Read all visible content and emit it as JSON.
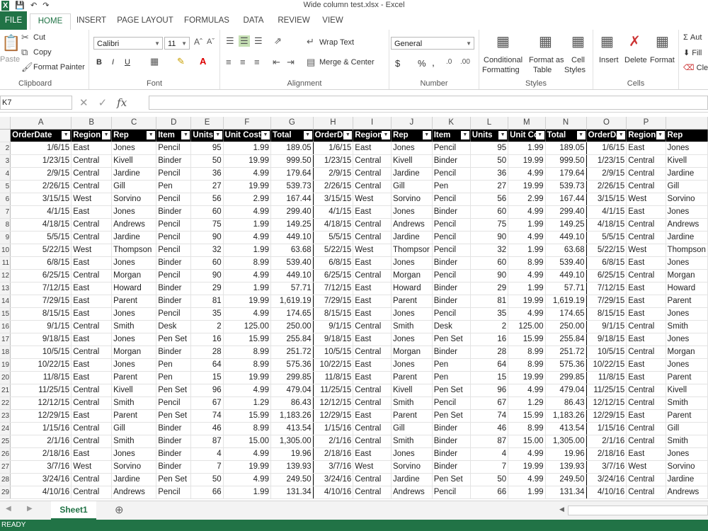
{
  "window": {
    "title": "Wide column test.xlsx - Excel"
  },
  "tabs": {
    "file": "FILE",
    "home": "HOME",
    "insert": "INSERT",
    "page_layout": "PAGE LAYOUT",
    "formulas": "FORMULAS",
    "data": "DATA",
    "review": "REVIEW",
    "view": "VIEW"
  },
  "ribbon": {
    "clipboard": {
      "paste": "Paste",
      "cut": "Cut",
      "copy": "Copy",
      "format_painter": "Format Painter",
      "label": "Clipboard"
    },
    "font": {
      "name": "Calibri",
      "size": "11",
      "bold": "B",
      "italic": "I",
      "underline": "U",
      "label": "Font"
    },
    "alignment": {
      "wrap_text": "Wrap Text",
      "merge_center": "Merge & Center",
      "label": "Alignment"
    },
    "number": {
      "format": "General",
      "currency": "$",
      "percent": "%",
      "comma": ",",
      "label": "Number"
    },
    "styles": {
      "conditional": "Conditional",
      "formatting": "Formatting",
      "format_as": "Format as",
      "table": "Table",
      "cell": "Cell",
      "styles": "Styles",
      "label": "Styles"
    },
    "cells": {
      "insert": "Insert",
      "delete": "Delete",
      "format": "Format",
      "label": "Cells"
    },
    "editing": {
      "autosum": "Aut",
      "fill": "Fill",
      "clear": "Clea"
    }
  },
  "formula_bar": {
    "name_box": "K7",
    "fx": "fx",
    "content": ""
  },
  "columns": [
    "A",
    "B",
    "C",
    "D",
    "E",
    "F",
    "G",
    "H",
    "I",
    "J",
    "K",
    "L",
    "M",
    "N",
    "O",
    "P"
  ],
  "headers": [
    "OrderDate",
    "Region",
    "Rep",
    "Item",
    "Units",
    "Unit Cost",
    "Total"
  ],
  "headers_cut": {
    "orderdate_h": "OrderDa",
    "unitcost_m": "Unit Co",
    "orderdate_o": "OrderDa",
    "rep_q": "Rep"
  },
  "rows": [
    [
      "1/6/15",
      "East",
      "Jones",
      "Pencil",
      "95",
      "1.99",
      "189.05"
    ],
    [
      "1/23/15",
      "Central",
      "Kivell",
      "Binder",
      "50",
      "19.99",
      "999.50"
    ],
    [
      "2/9/15",
      "Central",
      "Jardine",
      "Pencil",
      "36",
      "4.99",
      "179.64"
    ],
    [
      "2/26/15",
      "Central",
      "Gill",
      "Pen",
      "27",
      "19.99",
      "539.73"
    ],
    [
      "3/15/15",
      "West",
      "Sorvino",
      "Pencil",
      "56",
      "2.99",
      "167.44"
    ],
    [
      "4/1/15",
      "East",
      "Jones",
      "Binder",
      "60",
      "4.99",
      "299.40"
    ],
    [
      "4/18/15",
      "Central",
      "Andrews",
      "Pencil",
      "75",
      "1.99",
      "149.25"
    ],
    [
      "5/5/15",
      "Central",
      "Jardine",
      "Pencil",
      "90",
      "4.99",
      "449.10"
    ],
    [
      "5/22/15",
      "West",
      "Thompson",
      "Pencil",
      "32",
      "1.99",
      "63.68"
    ],
    [
      "6/8/15",
      "East",
      "Jones",
      "Binder",
      "60",
      "8.99",
      "539.40"
    ],
    [
      "6/25/15",
      "Central",
      "Morgan",
      "Pencil",
      "90",
      "4.99",
      "449.10"
    ],
    [
      "7/12/15",
      "East",
      "Howard",
      "Binder",
      "29",
      "1.99",
      "57.71"
    ],
    [
      "7/29/15",
      "East",
      "Parent",
      "Binder",
      "81",
      "19.99",
      "1,619.19"
    ],
    [
      "8/15/15",
      "East",
      "Jones",
      "Pencil",
      "35",
      "4.99",
      "174.65"
    ],
    [
      "9/1/15",
      "Central",
      "Smith",
      "Desk",
      "2",
      "125.00",
      "250.00"
    ],
    [
      "9/18/15",
      "East",
      "Jones",
      "Pen Set",
      "16",
      "15.99",
      "255.84"
    ],
    [
      "10/5/15",
      "Central",
      "Morgan",
      "Binder",
      "28",
      "8.99",
      "251.72"
    ],
    [
      "10/22/15",
      "East",
      "Jones",
      "Pen",
      "64",
      "8.99",
      "575.36"
    ],
    [
      "11/8/15",
      "East",
      "Parent",
      "Pen",
      "15",
      "19.99",
      "299.85"
    ],
    [
      "11/25/15",
      "Central",
      "Kivell",
      "Pen Set",
      "96",
      "4.99",
      "479.04"
    ],
    [
      "12/12/15",
      "Central",
      "Smith",
      "Pencil",
      "67",
      "1.29",
      "86.43"
    ],
    [
      "12/29/15",
      "East",
      "Parent",
      "Pen Set",
      "74",
      "15.99",
      "1,183.26"
    ],
    [
      "1/15/16",
      "Central",
      "Gill",
      "Binder",
      "46",
      "8.99",
      "413.54"
    ],
    [
      "2/1/16",
      "Central",
      "Smith",
      "Binder",
      "87",
      "15.00",
      "1,305.00"
    ],
    [
      "2/18/16",
      "East",
      "Jones",
      "Binder",
      "4",
      "4.99",
      "19.96"
    ],
    [
      "3/7/16",
      "West",
      "Sorvino",
      "Binder",
      "7",
      "19.99",
      "139.93"
    ],
    [
      "3/24/16",
      "Central",
      "Jardine",
      "Pen Set",
      "50",
      "4.99",
      "249.50"
    ],
    [
      "4/10/16",
      "Central",
      "Andrews",
      "Pencil",
      "66",
      "1.99",
      "131.34"
    ]
  ],
  "cut_reps": {
    "8": "Thompsor"
  },
  "row_numbers": [
    "",
    "2",
    "3",
    "4",
    "5",
    "6",
    "7",
    "8",
    "9",
    "10",
    "11",
    "12",
    "13",
    "14",
    "15",
    "16",
    "17",
    "18",
    "19",
    "20",
    "21",
    "22",
    "23",
    "24",
    "25",
    "26",
    "27",
    "28",
    "29"
  ],
  "sheet_tabs": [
    {
      "label": "Sheet1",
      "active": true
    }
  ],
  "status": {
    "ready": "READY"
  },
  "colors": {
    "excel_green": "#217346",
    "header_bg": "#000000"
  }
}
